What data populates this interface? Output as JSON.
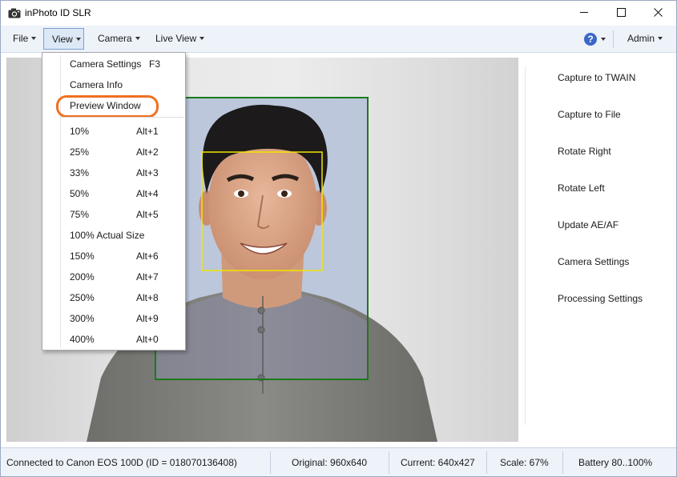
{
  "window": {
    "title": "inPhoto ID SLR",
    "app_icon": "camera-icon",
    "controls": [
      "minimize-icon",
      "maximize-icon",
      "close-icon"
    ]
  },
  "menubar": {
    "file": "File",
    "view": "View",
    "camera": "Camera",
    "live_view": "Live View",
    "help_icon": "help-icon",
    "admin": "Admin"
  },
  "view_menu": {
    "items": [
      {
        "label": "Camera Settings",
        "shortcut": "F3"
      },
      {
        "label": "Camera Info",
        "shortcut": ""
      },
      {
        "label": "Preview Window",
        "shortcut": ""
      },
      {
        "label": "10%",
        "shortcut": "Alt+1"
      },
      {
        "label": "25%",
        "shortcut": "Alt+2"
      },
      {
        "label": "33%",
        "shortcut": "Alt+3"
      },
      {
        "label": "50%",
        "shortcut": "Alt+4"
      },
      {
        "label": "75%",
        "shortcut": "Alt+5"
      },
      {
        "label": "100% Actual Size",
        "shortcut": ""
      },
      {
        "label": "150%",
        "shortcut": "Alt+6"
      },
      {
        "label": "200%",
        "shortcut": "Alt+7"
      },
      {
        "label": "250%",
        "shortcut": "Alt+8"
      },
      {
        "label": "300%",
        "shortcut": "Alt+9"
      },
      {
        "label": "400%",
        "shortcut": "Alt+0"
      }
    ],
    "highlighted_item": "Preview Window",
    "highlight_color": "#f07020"
  },
  "side_panel": {
    "buttons": [
      "Capture to TWAIN",
      "Capture to File",
      "Rotate Right",
      "Rotate Left",
      "Update AE/AF",
      "Camera Settings",
      "Processing Settings"
    ]
  },
  "preview": {
    "crop_frame_color": "#1a7a1a",
    "face_box_color": "#f2e600"
  },
  "status": {
    "connection": "Connected to Canon EOS 100D (ID = 018070136408)",
    "original": "Original: 960x640",
    "current": "Current: 640x427",
    "scale": "Scale: 67%",
    "battery": "Battery 80..100%"
  }
}
